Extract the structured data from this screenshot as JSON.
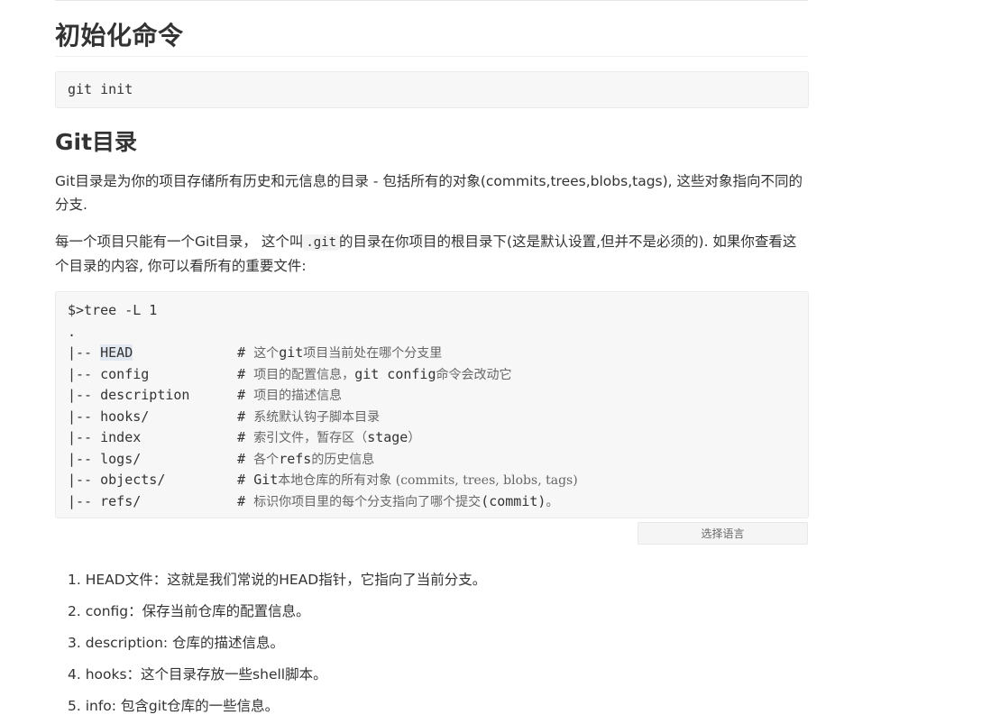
{
  "heading_init": "初始化命令",
  "init_code": "git init",
  "heading_git_dir": "Git目录",
  "para1": "Git目录是为你的项目存储所有历史和元信息的目录 - 包括所有的对象(commits,trees,blobs,tags), 这些对象指向不同的分支.",
  "para2_before": "每一个项目只能有一个Git目录， 这个叫",
  "para2_code": ".git",
  "para2_after": "的目录在你项目的根目录下(这是默认设置,但并不是必须的). 如果你查看这个目录的内容, 你可以看所有的重要文件:",
  "tree": {
    "command": "$>tree -L 1",
    "dot": ".",
    "lines": [
      {
        "prefix": "|-- ",
        "name": "HEAD",
        "hash": "#",
        "comment_parts": [
          "这个",
          "git",
          "项目当前处在哪个分支里"
        ]
      },
      {
        "prefix": "|-- ",
        "name": "config",
        "hash": "#",
        "comment_parts": [
          "项目的配置信息，",
          "git config",
          "命令会改动它"
        ]
      },
      {
        "prefix": "|-- ",
        "name": "description",
        "hash": "#",
        "comment_parts": [
          "项目的描述信息",
          "",
          ""
        ]
      },
      {
        "prefix": "|-- ",
        "name": "hooks/",
        "hash": "#",
        "comment_parts": [
          "系统默认钩子脚本目录",
          "",
          ""
        ]
      },
      {
        "prefix": "|-- ",
        "name": "index",
        "hash": "#",
        "comment_parts": [
          "索引文件，暂存区（",
          "stage",
          "）"
        ]
      },
      {
        "prefix": "|-- ",
        "name": "logs/",
        "hash": "#",
        "comment_parts": [
          "各个",
          "refs",
          "的历史信息"
        ]
      },
      {
        "prefix": "|-- ",
        "name": "objects/",
        "hash": "#",
        "comment_parts": [
          "",
          "Git",
          "本地仓库的所有对象 (commits, trees, blobs, tags)"
        ]
      },
      {
        "prefix": "|-- ",
        "name": "refs/",
        "hash": "#",
        "comment_parts": [
          "标识你项目里的每个分支指向了哪个提交",
          "(commit)",
          "。"
        ]
      }
    ]
  },
  "lang_button": "选择语言",
  "list_items": [
    "1. HEAD文件：这就是我们常说的HEAD指针，它指向了当前分支。",
    "2. config：保存当前仓库的配置信息。",
    "3. description: 仓库的描述信息。",
    "4. hooks：这个目录存放一些shell脚本。",
    "5. info: 包含git仓库的一些信息。"
  ]
}
